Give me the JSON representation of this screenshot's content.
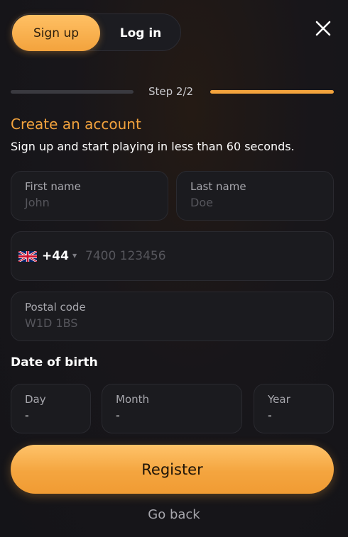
{
  "auth_tabs": {
    "signup_label": "Sign up",
    "login_label": "Log in",
    "active": "signup"
  },
  "close": {
    "icon": "close-icon"
  },
  "progress": {
    "step_label": "Step 2/2",
    "current_step": 2,
    "total_steps": 2
  },
  "header": {
    "title": "Create an account",
    "subtitle": "Sign up and start playing in less than 60 seconds."
  },
  "fields": {
    "first_name": {
      "label": "First name",
      "placeholder": "John"
    },
    "last_name": {
      "label": "Last name",
      "placeholder": "Doe"
    },
    "phone": {
      "flag_icon": "uk-flag-icon",
      "dial_code": "+44",
      "placeholder": "7400 123456"
    },
    "postal_code": {
      "label": "Postal code",
      "placeholder": "W1D 1BS"
    }
  },
  "dob": {
    "title": "Date of birth",
    "day": {
      "label": "Day",
      "value": "-"
    },
    "month": {
      "label": "Month",
      "value": "-"
    },
    "year": {
      "label": "Year",
      "value": "-"
    }
  },
  "actions": {
    "register_label": "Register",
    "go_back_label": "Go back"
  },
  "colors": {
    "accent": "#f3a33d",
    "background": "#141418",
    "field_bg": "#1b1b1f",
    "muted_text": "#a7a7ad"
  }
}
